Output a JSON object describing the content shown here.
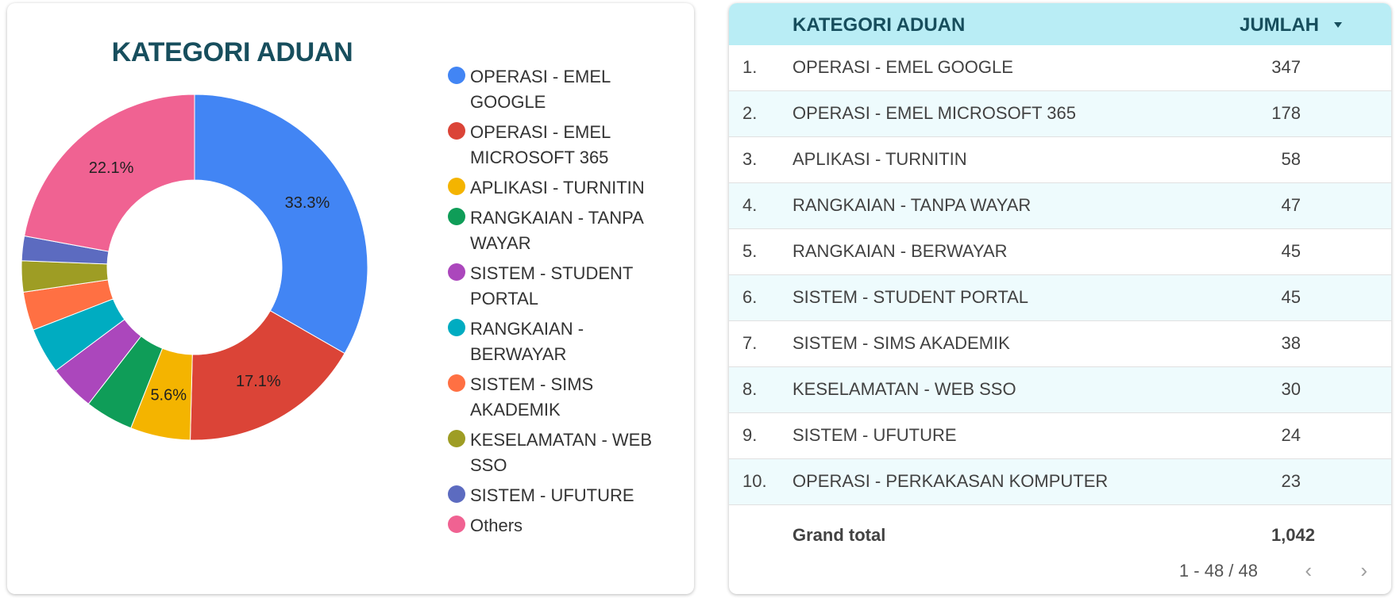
{
  "chart_data": [
    {
      "type": "donut",
      "title": "KATEGORI ADUAN",
      "slices": [
        {
          "name": "OPERASI - EMEL GOOGLE",
          "value": 33.3,
          "label": "33.3%",
          "color": "#4285f4"
        },
        {
          "name": "OPERASI - EMEL MICROSOFT 365",
          "value": 17.1,
          "label": "17.1%",
          "color": "#db4437"
        },
        {
          "name": "APLIKASI - TURNITIN",
          "value": 5.6,
          "label": "5.6%",
          "color": "#f4b400"
        },
        {
          "name": "RANGKAIAN - TANPA WAYAR",
          "value": 4.5,
          "label": "",
          "color": "#0f9d58"
        },
        {
          "name": "SISTEM - STUDENT PORTAL",
          "value": 4.3,
          "label": "",
          "color": "#ab47bc"
        },
        {
          "name": "RANGKAIAN - BERWAYAR",
          "value": 4.3,
          "label": "",
          "color": "#00acc1"
        },
        {
          "name": "SISTEM - SIMS AKADEMIK",
          "value": 3.6,
          "label": "",
          "color": "#ff7043"
        },
        {
          "name": "KESELAMATAN - WEB SSO",
          "value": 2.9,
          "label": "",
          "color": "#9e9d24"
        },
        {
          "name": "SISTEM - UFUTURE",
          "value": 2.3,
          "label": "",
          "color": "#5c6bc0"
        },
        {
          "name": "Others",
          "value": 22.1,
          "label": "22.1%",
          "color": "#f06292"
        }
      ]
    },
    {
      "type": "table",
      "columns": [
        "KATEGORI ADUAN",
        "JUMLAH"
      ],
      "rows": [
        {
          "idx": "1.",
          "category": "OPERASI - EMEL GOOGLE",
          "value": "347"
        },
        {
          "idx": "2.",
          "category": "OPERASI - EMEL MICROSOFT 365",
          "value": "178"
        },
        {
          "idx": "3.",
          "category": "APLIKASI - TURNITIN",
          "value": "58"
        },
        {
          "idx": "4.",
          "category": "RANGKAIAN - TANPA WAYAR",
          "value": "47"
        },
        {
          "idx": "5.",
          "category": "RANGKAIAN - BERWAYAR",
          "value": "45"
        },
        {
          "idx": "6.",
          "category": "SISTEM - STUDENT PORTAL",
          "value": "45"
        },
        {
          "idx": "7.",
          "category": "SISTEM - SIMS AKADEMIK",
          "value": "38"
        },
        {
          "idx": "8.",
          "category": "KESELAMATAN - WEB SSO",
          "value": "30"
        },
        {
          "idx": "9.",
          "category": "SISTEM - UFUTURE",
          "value": "24"
        },
        {
          "idx": "10.",
          "category": "OPERASI - PERKAKASAN KOMPUTER",
          "value": "23"
        }
      ],
      "grand_total_label": "Grand total",
      "grand_total": "1,042",
      "sort": "JUMLAH descending"
    }
  ],
  "legend": {
    "items": [
      {
        "label": "OPERASI - EMEL GOOGLE",
        "color": "#4285f4"
      },
      {
        "label": "OPERASI - EMEL MICROSOFT 365",
        "color": "#db4437"
      },
      {
        "label": "APLIKASI - TURNITIN",
        "color": "#f4b400"
      },
      {
        "label": "RANGKAIAN - TANPA WAYAR",
        "color": "#0f9d58"
      },
      {
        "label": "SISTEM - STUDENT PORTAL",
        "color": "#ab47bc"
      },
      {
        "label": "RANGKAIAN - BERWAYAR",
        "color": "#00acc1"
      },
      {
        "label": "SISTEM - SIMS AKADEMIK",
        "color": "#ff7043"
      },
      {
        "label": "KESELAMATAN - WEB SSO",
        "color": "#9e9d24"
      },
      {
        "label": "SISTEM - UFUTURE",
        "color": "#5c6bc0"
      },
      {
        "label": "Others",
        "color": "#f06292"
      }
    ]
  },
  "pager": {
    "text": "1 - 48 / 48",
    "prev_icon": "chevron-left-icon",
    "next_icon": "chevron-right-icon"
  },
  "colors": {
    "title": "#174e5d",
    "table_header_bg": "#b9edf5",
    "table_alt_row_bg": "#eefbfd"
  }
}
